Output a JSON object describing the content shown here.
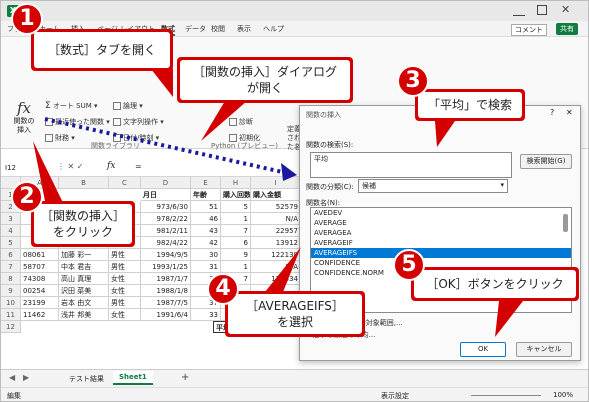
{
  "ribbon_tabs": [
    "ファイル",
    "ホーム",
    "挿入",
    "ページ レイアウト",
    "数式",
    "データ",
    "校閲",
    "表示",
    "ヘルプ"
  ],
  "window_controls": {
    "comment": "コメント",
    "share": "共有"
  },
  "ribbon": {
    "fx_label": "fx",
    "insert_function_label": "関数の挿入",
    "autosum": "オート SUM",
    "recent": "最近使った関数",
    "financial": "財務",
    "logical": "論理",
    "text": "文字列操作",
    "datetime": "日付/時刻",
    "diagnostic": "診断",
    "initialize": "初期化",
    "defined_name": "定義された名",
    "group_library": "関数ライブラリ",
    "group_python": "Python (プレビュー)"
  },
  "name_box": "I12",
  "formula_bar": {
    "fx": "fx",
    "value": "="
  },
  "columns": [
    "A",
    "B",
    "C",
    "D",
    "E",
    "H",
    "I"
  ],
  "header_row": [
    "",
    "",
    "",
    "月日",
    "年齢",
    "購入回数",
    "購入金額"
  ],
  "rows": [
    {
      "num": "2",
      "a": "",
      "b": "",
      "c": "",
      "d": "973/6/30",
      "e": "51",
      "h": "5",
      "i": "52579"
    },
    {
      "num": "3",
      "a": "",
      "b": "",
      "c": "",
      "d": "978/2/22",
      "e": "46",
      "h": "1",
      "i": "N/A"
    },
    {
      "num": "4",
      "a": "",
      "b": "",
      "c": "",
      "d": "981/2/11",
      "e": "43",
      "h": "7",
      "i": "22957"
    },
    {
      "num": "5",
      "a": "",
      "b": "",
      "c": "",
      "d": "982/4/22",
      "e": "42",
      "h": "6",
      "i": "13912"
    },
    {
      "num": "6",
      "a": "08061",
      "b": "加藤 彩一",
      "c": "男性",
      "d": "1994/9/5",
      "e": "30",
      "h": "9",
      "i": "122138"
    },
    {
      "num": "7",
      "a": "58707",
      "b": "中本 君吉",
      "c": "男性",
      "d": "1993/1/25",
      "e": "31",
      "h": "1",
      "i": "N/A"
    },
    {
      "num": "8",
      "a": "74308",
      "b": "高山 真理",
      "c": "女性",
      "d": "1987/1/7",
      "e": "37",
      "h": "7",
      "i": "125334"
    },
    {
      "num": "9",
      "a": "00254",
      "b": "沢田 菜美",
      "c": "女性",
      "d": "1988/1/8",
      "e": "36",
      "h": "",
      "i": ""
    },
    {
      "num": "10",
      "a": "23199",
      "b": "岩本 由文",
      "c": "男性",
      "d": "1987/7/5",
      "e": "37",
      "h": "",
      "i": ""
    },
    {
      "num": "11",
      "a": "11462",
      "b": "浅井 邦美",
      "c": "女性",
      "d": "1991/6/4",
      "e": "33",
      "h": "",
      "i": ""
    }
  ],
  "cell_12_label": "平均",
  "sheet_tabs": [
    "テスト結果",
    "Sheet1"
  ],
  "add_sheet": "+",
  "status": {
    "mode": "編集",
    "display": "表示設定",
    "zoom": "100%"
  },
  "dialog": {
    "title": "関数の挿入",
    "search_label": "関数の検索(S):",
    "search_value": "平均",
    "search_button": "検索開始(G)",
    "category_label": "関数の分類(C):",
    "category_value": "候補",
    "name_label": "関数名(N):",
    "functions": [
      "AVEDEV",
      "AVERAGE",
      "AVERAGEA",
      "AVERAGEIF",
      "AVERAGEIFS",
      "CONFIDENCE",
      "CONFIDENCE.NORM"
    ],
    "selected_function": "AVERAGEIFS",
    "description_line1": "AVERAGEIFS(平均対象範囲,...",
    "description_line2": "...定する数値の平均...",
    "ok": "OK",
    "cancel": "キャンセル"
  },
  "callouts": {
    "c1": {
      "badge": "1",
      "text": "［数式］タブを開く"
    },
    "c2": {
      "badge": "2",
      "line1": "［関数の挿入］",
      "line2": "をクリック"
    },
    "c3": {
      "badge": "3",
      "text": "「平均」で検索"
    },
    "c4": {
      "badge": "4",
      "line1": "［AVERAGEIFS］",
      "line2": "を選択"
    },
    "c5": {
      "badge": "5",
      "text": "［OK］ボタンをクリック"
    },
    "c6": {
      "line1": "［関数の挿入］ダイアログ",
      "line2": "が開く"
    }
  }
}
